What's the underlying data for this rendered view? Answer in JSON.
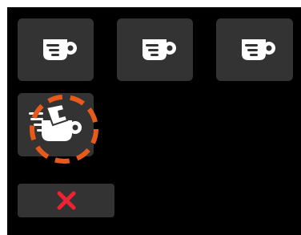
{
  "screen": {
    "background": "#000000",
    "tile_color": "#333333",
    "highlight_color": "#e85a1c",
    "cancel_color": "#ee2233"
  },
  "tiles": [
    {
      "icon": "coffee-cup-icon"
    },
    {
      "icon": "coffee-cup-icon"
    },
    {
      "icon": "coffee-cup-icon"
    },
    {
      "icon": "hot-water-pour-icon",
      "highlighted": true
    }
  ],
  "cancel": {
    "icon": "close-icon"
  }
}
